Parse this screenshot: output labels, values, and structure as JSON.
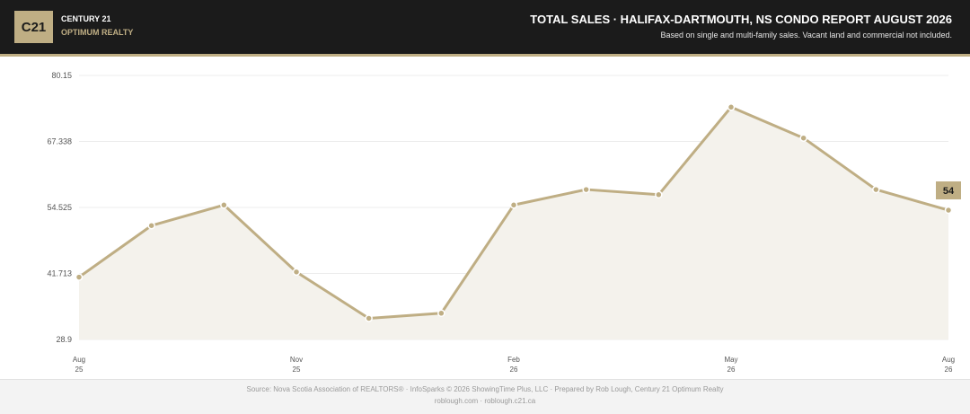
{
  "header": {
    "logo_text": "C21",
    "brand_name": "CENTURY 21",
    "brand_sub": "OPTIMUM REALTY",
    "title": "TOTAL SALES  ·  HALIFAX-DARTMOUTH, NS CONDO REPORT AUGUST 2026",
    "subtitle": "Based on single and multi-family sales. Vacant land and commercial not included."
  },
  "colors": {
    "accent": "#bfae84",
    "header_bg": "#1b1b1b",
    "area_fill": "#f4f2ec",
    "grid": "#ececec",
    "badge_bg": "#bfae84"
  },
  "chart_data": {
    "type": "area",
    "x": [
      "2025-08",
      "2025-09",
      "2025-10",
      "2025-11",
      "2025-12",
      "2026-01",
      "2026-02",
      "2026-03",
      "2026-04",
      "2026-05",
      "2026-06",
      "2026-07",
      "2026-08"
    ],
    "series": [
      {
        "values": [
          41,
          51,
          55,
          42,
          33,
          34,
          55,
          58,
          57,
          74,
          68,
          58,
          54
        ]
      }
    ],
    "y_ticks": [
      "28.9",
      "41.713",
      "54.525",
      "67.338",
      "80.15"
    ],
    "ylim": [
      28.9,
      80.15
    ],
    "x_ticks": [
      {
        "month": "Aug",
        "year": "25",
        "index": 0
      },
      {
        "month": "Nov",
        "year": "25",
        "index": 3
      },
      {
        "month": "Feb",
        "year": "26",
        "index": 6
      },
      {
        "month": "May",
        "year": "26",
        "index": 9
      },
      {
        "month": "Aug",
        "year": "26",
        "index": 12
      }
    ],
    "last_value_label": "54",
    "grid": true,
    "legend": "none"
  },
  "footer": {
    "source": "Source: Nova Scotia Association of REALTORS® · InfoSparks © 2026 ShowingTime Plus, LLC · Prepared by Rob Lough, Century 21 Optimum Realty",
    "links": "roblough.com · roblough.c21.ca"
  }
}
